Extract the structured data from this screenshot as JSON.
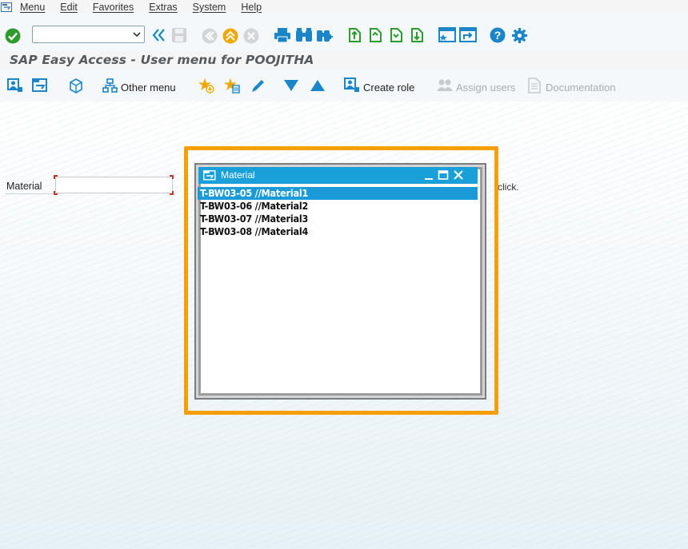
{
  "menubar": {
    "items": [
      "Menu",
      "Edit",
      "Favorites",
      "Extras",
      "System",
      "Help"
    ]
  },
  "title": {
    "text": "SAP Easy Access  -  User menu for POOJITHA"
  },
  "command_field": {
    "value": ""
  },
  "app_toolbar": {
    "other_menu": "Other menu",
    "create_role": "Create role",
    "assign_users": "Assign users",
    "documentation": "Documentation"
  },
  "field": {
    "label": "Material",
    "value": ""
  },
  "background_text": "click.",
  "popup": {
    "title": "Material",
    "items": [
      "T-BW03-05 //Material1",
      "T-BW03-06 //Material2",
      "T-BW03-07 //Material3",
      "T-BW03-08 //Material4"
    ],
    "selected_index": 0
  },
  "colors": {
    "accent": "#1aa0d8",
    "highlight": "#f5a000",
    "green": "#2e9b2e"
  }
}
